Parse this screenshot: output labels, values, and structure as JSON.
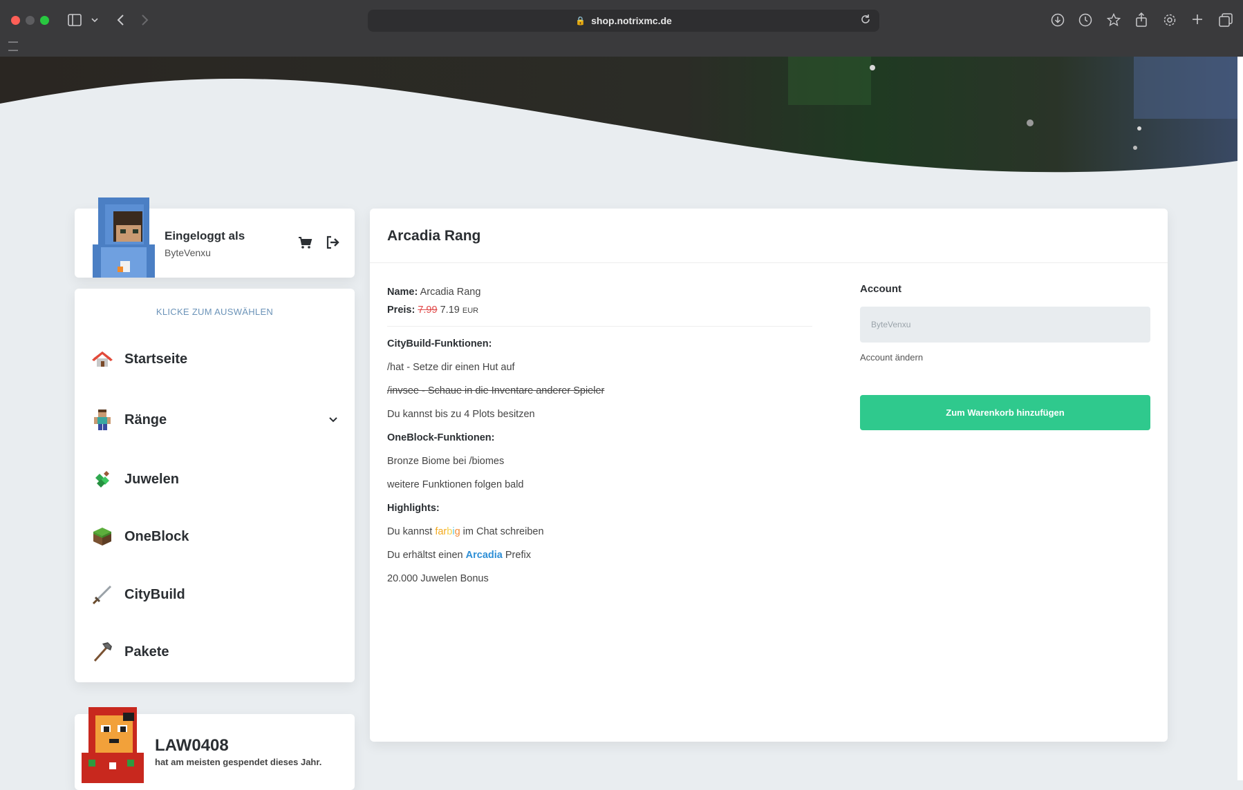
{
  "browser": {
    "url": "shop.notrixmc.de",
    "icons": [
      "sidebar-icon",
      "chevron-down-icon",
      "back-icon",
      "forward-icon",
      "lock-icon",
      "reload-icon",
      "download-icon",
      "history-icon",
      "star-icon",
      "share-icon",
      "settings-icon",
      "new-tab-icon",
      "tabs-overview-icon"
    ]
  },
  "user": {
    "logged_in_label": "Eingeloggt als",
    "username": "ByteVenxu"
  },
  "nav": {
    "hint": "KLICKE ZUM AUSWÄHLEN",
    "items": [
      {
        "label": "Startseite",
        "icon": "house-icon"
      },
      {
        "label": "Ränge",
        "icon": "character-icon"
      },
      {
        "label": "Juwelen",
        "icon": "gems-icon"
      },
      {
        "label": "OneBlock",
        "icon": "grass-block-icon"
      },
      {
        "label": "CityBuild",
        "icon": "sword-icon"
      },
      {
        "label": "Pakete",
        "icon": "axe-icon"
      }
    ]
  },
  "donor": {
    "name": "LAW0408",
    "text": "hat am meisten gespendet dieses Jahr."
  },
  "product": {
    "title": "Arcadia Rang",
    "name_label": "Name:",
    "name_value": "Arcadia Rang",
    "price_label": "Preis:",
    "price_old": "7.99",
    "price_new": "7.19",
    "currency": "EUR",
    "features": {
      "citybuild_head": "CityBuild-Funktionen:",
      "hat": "/hat - Setze dir einen Hut auf",
      "invsee": "/invsee - Schaue in die Inventare anderer Spieler",
      "plots": "Du kannst bis zu 4 Plots besitzen",
      "oneblock_head": "OneBlock-Funktionen:",
      "biome": "Bronze Biome bei /biomes",
      "more": "weitere Funktionen folgen bald",
      "highlights_head": "Highlights:",
      "chat_pre": "Du kannst",
      "chat_post": "im Chat schreiben",
      "farbig_letters": [
        "far",
        "b",
        "i",
        "g"
      ],
      "prefix_pre": "Du erhältst einen",
      "prefix_name": "Arcadia",
      "prefix_post": "Prefix",
      "bonus": "20.000 Juwelen Bonus"
    }
  },
  "account": {
    "label": "Account",
    "input_value": "ByteVenxu",
    "change_link": "Account ändern",
    "add_to_cart": "Zum Warenkorb hinzufügen"
  },
  "colors": {
    "accent_green": "#2fc98d",
    "price_old_red": "#e04646",
    "arcadia_blue": "#2e8fd6",
    "hint_blue": "#6b93b8"
  }
}
